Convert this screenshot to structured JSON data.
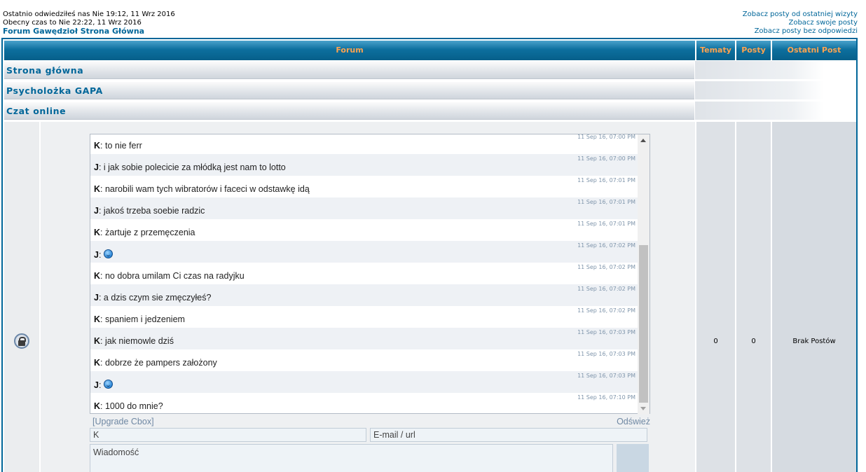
{
  "header": {
    "last_visit": "Ostatnio odwiedziłeś nas Nie 19:12, 11 Wrz 2016",
    "current_time": "Obecny czas to Nie 22:22, 11 Wrz 2016",
    "forum_index": "Forum Gawędzioł Strona Główna",
    "links": [
      "Zobacz posty od ostatniej wizyty",
      "Zobacz swoje posty",
      "Zobacz posty bez odpowiedzi"
    ]
  },
  "table": {
    "headers": {
      "forum": "Forum",
      "topics": "Tematy",
      "posts": "Posty",
      "last_post": "Ostatni Post"
    },
    "categories": [
      "Strona główna",
      "Psycholożka GAPA",
      "Czat online"
    ],
    "row": {
      "topics": "0",
      "posts": "0",
      "last_post": "Brak Postów",
      "icon": "lock-icon"
    }
  },
  "cbox": {
    "messages": [
      {
        "user": "K",
        "text": "to nie ferr",
        "time": "11 Sep 16, 07:00 PM"
      },
      {
        "user": "J",
        "text": "i jak sobie polecicie za młódką jest nam to lotto",
        "time": "11 Sep 16, 07:00 PM"
      },
      {
        "user": "K",
        "text": "narobili wam tych wibratorów i faceci w odstawkę idą",
        "time": "11 Sep 16, 07:01 PM"
      },
      {
        "user": "J",
        "text": "jakoś trzeba soebie radzic",
        "time": "11 Sep 16, 07:01 PM"
      },
      {
        "user": "K",
        "text": "żartuje z przemęczenia",
        "time": "11 Sep 16, 07:01 PM"
      },
      {
        "user": "J",
        "text": "",
        "smiley": true,
        "time": "11 Sep 16, 07:02 PM"
      },
      {
        "user": "K",
        "text": "no dobra umilam Ci czas na radyjku",
        "time": "11 Sep 16, 07:02 PM"
      },
      {
        "user": "J",
        "text": "a dzis czym sie zmęczyłeś?",
        "time": "11 Sep 16, 07:02 PM"
      },
      {
        "user": "K",
        "text": "spaniem i jedzeniem",
        "time": "11 Sep 16, 07:02 PM"
      },
      {
        "user": "K",
        "text": "jak niemowle dziś",
        "time": "11 Sep 16, 07:03 PM"
      },
      {
        "user": "K",
        "text": "dobrze że pampers założony",
        "time": "11 Sep 16, 07:03 PM"
      },
      {
        "user": "J",
        "text": "",
        "smiley": true,
        "time": "11 Sep 16, 07:03 PM"
      },
      {
        "user": "K",
        "text": "1000 do mnie?",
        "time": "11 Sep 16, 07:10 PM"
      }
    ],
    "upgrade_label": "[Upgrade Cbox]",
    "refresh_label": "Odśwież",
    "name_value": "K",
    "email_placeholder": "E-mail / url",
    "message_placeholder": "Wiadomość"
  }
}
